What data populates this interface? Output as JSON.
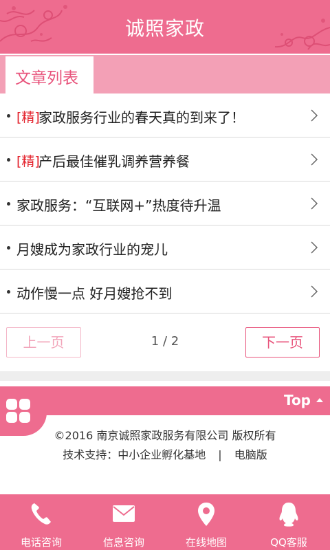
{
  "header": {
    "title": "诚照家政"
  },
  "section": {
    "tab_label": "文章列表"
  },
  "articles": [
    {
      "tag": "[精]",
      "title": "家政服务行业的春天真的到来了！"
    },
    {
      "tag": "[精]",
      "title": "产后最佳催乳调养营养餐"
    },
    {
      "tag": "",
      "title": "家政服务：“互联网+”热度待升温"
    },
    {
      "tag": "",
      "title": "月嫂成为家政行业的宠儿"
    },
    {
      "tag": "",
      "title": "动作慢一点 好月嫂抢不到"
    }
  ],
  "pager": {
    "prev_label": "上一页",
    "next_label": "下一页",
    "indicator": "1 / 2"
  },
  "top_link": {
    "label": "Top"
  },
  "footer": {
    "copyright": "©2016 南京诚照家政服务有限公司 版权所有",
    "support": "技术支持：中小企业孵化基地",
    "separator": "|",
    "desktop_link": "电脑版"
  },
  "bottom_nav": [
    {
      "label": "电话咨询",
      "icon": "phone-icon"
    },
    {
      "label": "信息咨询",
      "icon": "mail-icon"
    },
    {
      "label": "在线地图",
      "icon": "map-pin-icon"
    },
    {
      "label": "QQ客服",
      "icon": "qq-icon"
    }
  ],
  "colors": {
    "brand_pink": "#ee6c8f",
    "light_pink": "#f3a0b6",
    "accent_red": "#e3202a"
  }
}
